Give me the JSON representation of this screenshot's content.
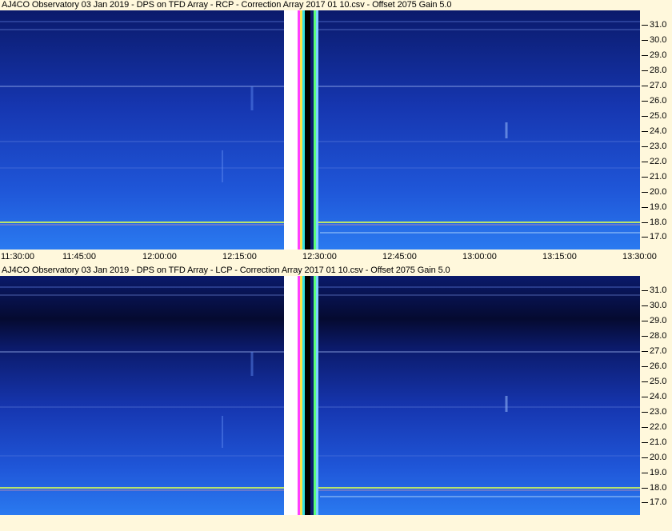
{
  "panels": [
    {
      "title": "AJ4CO Observatory 03 Jan 2019  -  DPS on TFD Array  -  RCP  -  Correction Array 2017 01 10.csv  -  Offset 2075  Gain 5.0"
    },
    {
      "title": "AJ4CO Observatory 03 Jan 2019  -  DPS on TFD Array  -  LCP  -  Correction Array 2017 01 10.csv  -  Offset 2075  Gain 5.0"
    }
  ],
  "frequency_ticks": [
    "31.0",
    "30.0",
    "29.0",
    "28.0",
    "27.0",
    "26.0",
    "25.0",
    "24.0",
    "23.0",
    "22.0",
    "21.0",
    "20.0",
    "19.0",
    "18.0",
    "17.0"
  ],
  "time_ticks": [
    "11:30:00",
    "11:45:00",
    "12:00:00",
    "12:15:00",
    "12:30:00",
    "12:45:00",
    "13:00:00",
    "13:15:00",
    "13:30:00"
  ],
  "colors": {
    "background": "#fff8dc",
    "spectrum_dark": "#0a1a6b",
    "spectrum_light": "#2a7af0",
    "gap": "#ffffff"
  }
}
